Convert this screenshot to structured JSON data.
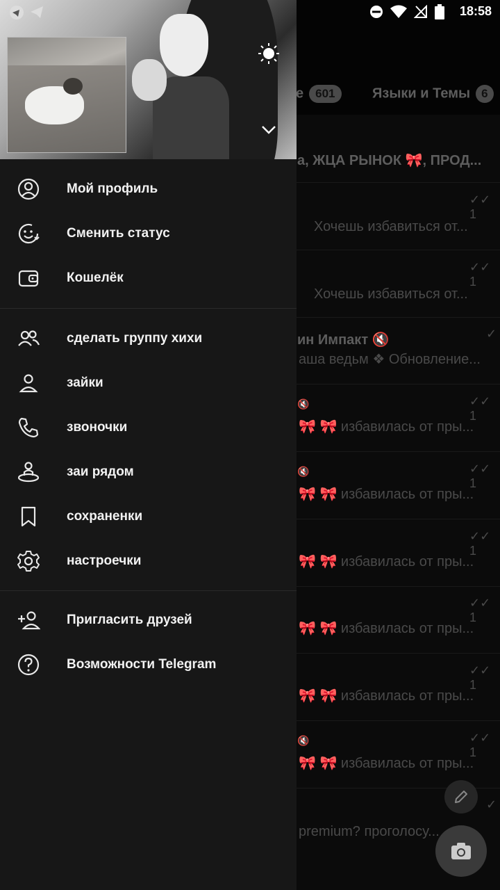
{
  "status_bar": {
    "time": "18:58"
  },
  "background": {
    "tabs": [
      {
        "label": "е",
        "badge": "601"
      },
      {
        "label": "Языки и Темы",
        "badge": "6"
      }
    ],
    "chats": [
      {
        "title": "а, ЖЦА РЫНОК 🎀, ПРОД...",
        "message": "",
        "ticks": ""
      },
      {
        "title": "",
        "message": "Хочешь избавиться от...",
        "ticks": "✓✓ 1"
      },
      {
        "title": "",
        "message": "Хочешь избавиться от...",
        "ticks": "✓✓ 1"
      },
      {
        "title": "ин Импакт 🔇",
        "message": "аша ведьм ❖ Обновление...",
        "ticks": "✓"
      },
      {
        "title": "🔇",
        "message": "🎀 🎀 избавилась от пры...",
        "ticks": "✓✓ 1"
      },
      {
        "title": "🔇",
        "message": "🎀 🎀 избавилась от пры...",
        "ticks": "✓✓ 1"
      },
      {
        "title": "",
        "message": "🎀 🎀 избавилась от пры...",
        "ticks": "✓✓ 1"
      },
      {
        "title": "",
        "message": "🎀 🎀 избавилась от пры...",
        "ticks": "✓✓ 1"
      },
      {
        "title": "",
        "message": "🎀 🎀 избавилась от пры...",
        "ticks": "✓✓ 1"
      },
      {
        "title": "🔇",
        "message": "🎀 🎀 избавилась от пры...",
        "ticks": "✓✓ 1"
      },
      {
        "title": "",
        "message": "premium? проголосу...",
        "ticks": "✓"
      }
    ]
  },
  "drawer": {
    "menu_primary": [
      {
        "label": "Мой профиль",
        "icon": "profile-icon"
      },
      {
        "label": "Сменить статус",
        "icon": "status-icon"
      },
      {
        "label": "Кошелёк",
        "icon": "wallet-icon"
      }
    ],
    "menu_secondary": [
      {
        "label": "сделать группу хихи",
        "icon": "group-icon"
      },
      {
        "label": "зайки",
        "icon": "contacts-icon"
      },
      {
        "label": "звоночки",
        "icon": "phone-icon"
      },
      {
        "label": "заи рядом",
        "icon": "nearby-icon"
      },
      {
        "label": "сохраненки",
        "icon": "bookmark-icon"
      },
      {
        "label": "настроечки",
        "icon": "settings-icon"
      }
    ],
    "menu_tertiary": [
      {
        "label": "Пригласить друзей",
        "icon": "invite-icon"
      },
      {
        "label": "Возможности Telegram",
        "icon": "help-icon"
      }
    ]
  }
}
